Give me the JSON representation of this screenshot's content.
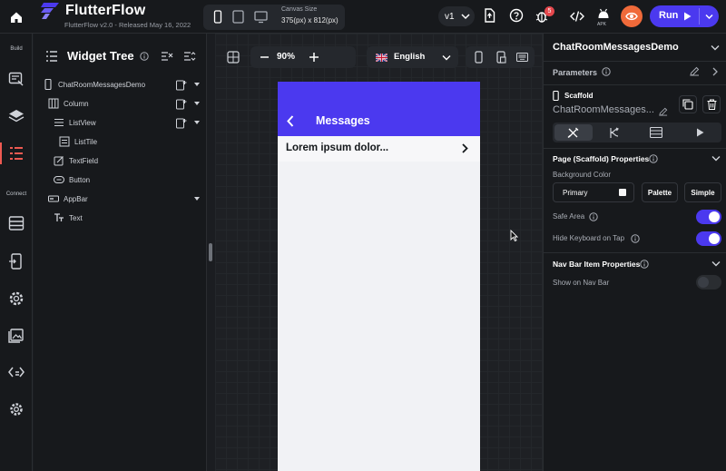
{
  "topbar": {
    "app_name": "FlutterFlow",
    "version_line": "FlutterFlow v2.0 - Released May 16, 2022",
    "canvas_size_label": "Canvas Size",
    "canvas_size_value": "375(px) x 812(px)",
    "branch_version": "v1",
    "notification_count": "5",
    "apk_label": "APK",
    "run_label": "Run"
  },
  "rail": {
    "build_label": "Build",
    "connect_label": "Connect"
  },
  "widget_tree": {
    "title": "Widget Tree",
    "items": [
      {
        "label": "ChatRoomMessagesDemo"
      },
      {
        "label": "Column"
      },
      {
        "label": "ListView"
      },
      {
        "label": "ListTile"
      },
      {
        "label": "TextField"
      },
      {
        "label": "Button"
      },
      {
        "label": "AppBar"
      },
      {
        "label": "Text"
      }
    ]
  },
  "canvas": {
    "zoom": "90%",
    "language": "English",
    "appbar_title": "Messages",
    "tile_title": "Lorem ipsum dolor..."
  },
  "properties": {
    "page_name": "ChatRoomMessagesDemo",
    "parameters_label": "Parameters",
    "widget_type": "Scaffold",
    "widget_name": "ChatRoomMessages...",
    "section_page": "Page (Scaffold) Properties",
    "bg_color_label": "Background Color",
    "bg_color_value": "Primary",
    "palette_label": "Palette",
    "simple_label": "Simple",
    "safe_area_label": "Safe Area",
    "safe_area_on": true,
    "hide_keyboard_label": "Hide Keyboard on Tap",
    "hide_keyboard_on": true,
    "section_nav": "Nav Bar Item Properties",
    "show_nav_label": "Show on Nav Bar",
    "show_nav_on": false
  },
  "colors": {
    "accent": "#4b39ef",
    "preview": "#f06a3a",
    "active_rail": "#ee5a52"
  }
}
